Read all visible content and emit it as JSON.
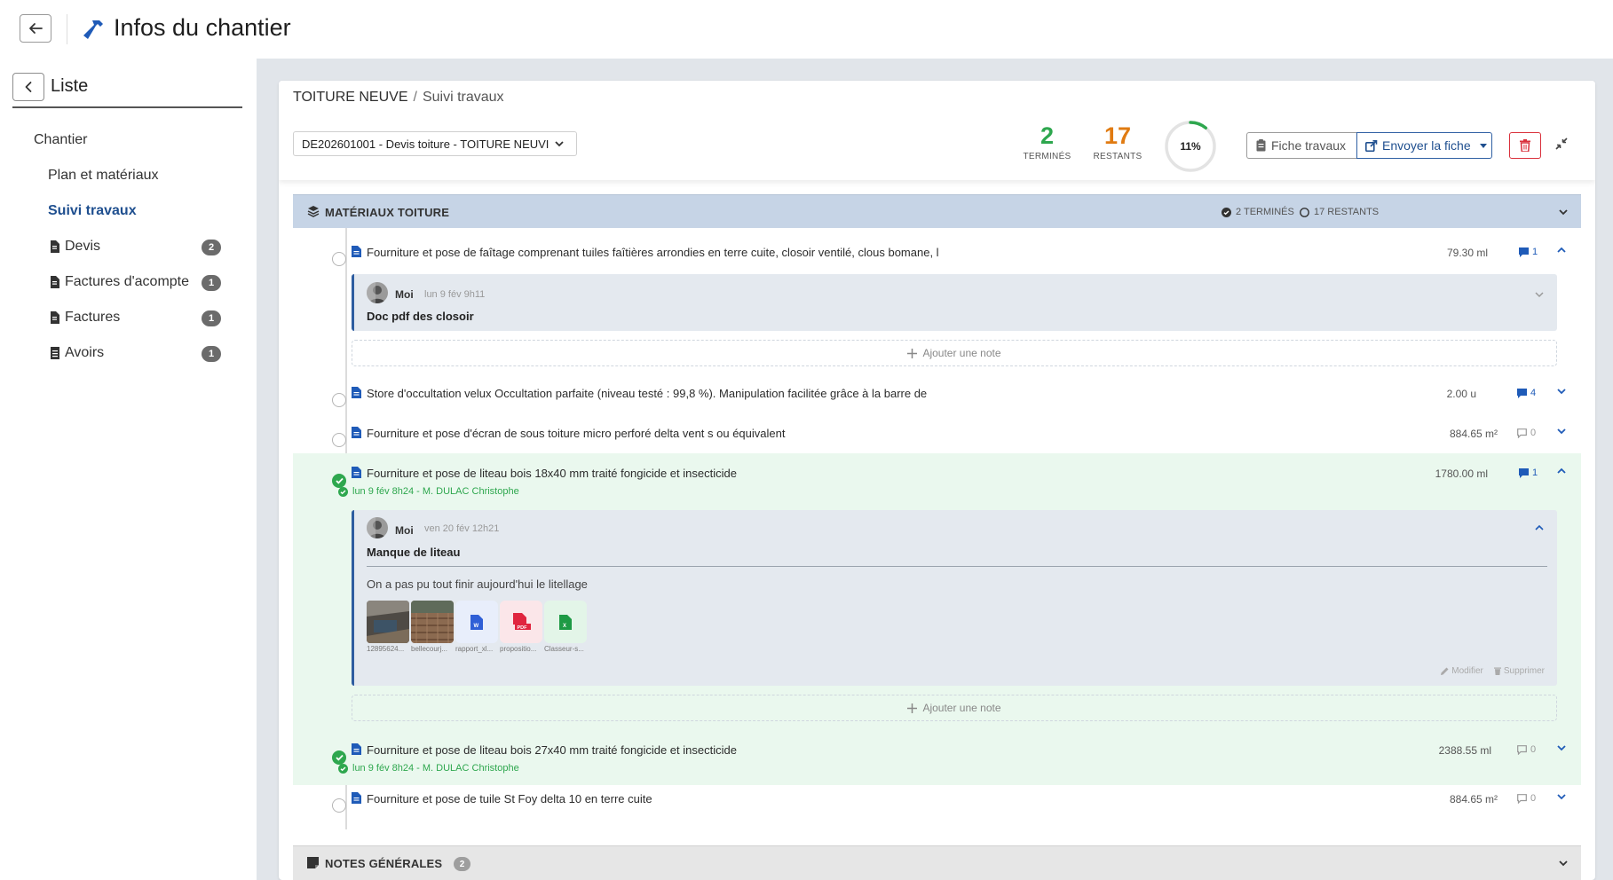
{
  "header": {
    "title": "Infos du chantier"
  },
  "sidebar": {
    "back_label": "Liste",
    "section": "Chantier",
    "items": [
      {
        "label": "Plan et matériaux",
        "active": false
      },
      {
        "label": "Suivi travaux",
        "active": true
      },
      {
        "label": "Devis",
        "count": "2"
      },
      {
        "label": "Factures d'acompte",
        "count": "1"
      },
      {
        "label": "Factures",
        "count": "1"
      },
      {
        "label": "Avoirs",
        "count": "1"
      }
    ]
  },
  "breadcrumb": {
    "part1": "TOITURE NEUVE",
    "separator": "/",
    "part2": "Suivi travaux"
  },
  "devis_select": {
    "value": "DE202601001 - Devis toiture - TOITURE NEUVI"
  },
  "stats": {
    "done": {
      "value": "2",
      "label": "TERMINÉS",
      "color": "#2ea74e"
    },
    "remaining": {
      "value": "17",
      "label": "RESTANTS",
      "color": "#e07b12"
    },
    "progress": {
      "label": "11%",
      "fraction": 0.11
    }
  },
  "toolbar": {
    "fiche": "Fiche travaux",
    "envoyer": "Envoyer la fiche"
  },
  "section_materiaux": {
    "title": "MATÉRIAUX TOITURE",
    "done": "2 TERMINÉS",
    "remaining": "17 RESTANTS"
  },
  "items": [
    {
      "title": "Fourniture et pose de faîtage comprenant tuiles faîtières arrondies en terre cuite, closoir ventilé, clous bomane, l",
      "qty": "79.30 ml",
      "notes": "1",
      "done": false,
      "expanded": true,
      "note": {
        "author": "Moi",
        "date": "lun 9 fév 9h11",
        "title": "Doc pdf des closoir"
      }
    },
    {
      "title": "Store d'occultation velux Occultation parfaite (niveau testé : 99,8 %). Manipulation facilitée grâce à la barre de",
      "qty": "2.00 u",
      "notes": "4",
      "done": false
    },
    {
      "title": "Fourniture et pose d'écran de sous toiture micro perforé delta vent s ou équivalent",
      "qty": "884.65 m²",
      "notes": "0",
      "done": false
    },
    {
      "title": "Fourniture et pose de liteau bois 18x40 mm traité fongicide et insecticide",
      "qty": "1780.00 ml",
      "notes": "1",
      "done": true,
      "done_info": "lun 9 fév 8h24 - M. DULAC Christophe",
      "expanded": true,
      "note": {
        "author": "Moi",
        "date": "ven 20 fév 12h21",
        "title": "Manque de liteau",
        "body": "On a pas pu tout finir aujourd'hui le litellage",
        "attachments": [
          {
            "name": "12895624...",
            "kind": "photo"
          },
          {
            "name": "bellecourj...",
            "kind": "photo"
          },
          {
            "name": "rapport_xl...",
            "kind": "word"
          },
          {
            "name": "propositio...",
            "kind": "pdf"
          },
          {
            "name": "Classeur-s...",
            "kind": "excel"
          }
        ],
        "edit": "Modifier",
        "delete": "Supprimer"
      }
    },
    {
      "title": "Fourniture et pose de liteau bois 27x40 mm traité fongicide et insecticide",
      "qty": "2388.55 ml",
      "notes": "0",
      "done": true,
      "done_info": "lun 9 fév 8h24 - M. DULAC Christophe"
    },
    {
      "title": "Fourniture et pose de tuile St Foy delta 10 en terre cuite",
      "qty": "884.65 m²",
      "notes": "0",
      "done": false
    }
  ],
  "add_note_label": "Ajouter une note",
  "section_generales": {
    "title": "NOTES GÉNÉRALES",
    "count": "2"
  }
}
